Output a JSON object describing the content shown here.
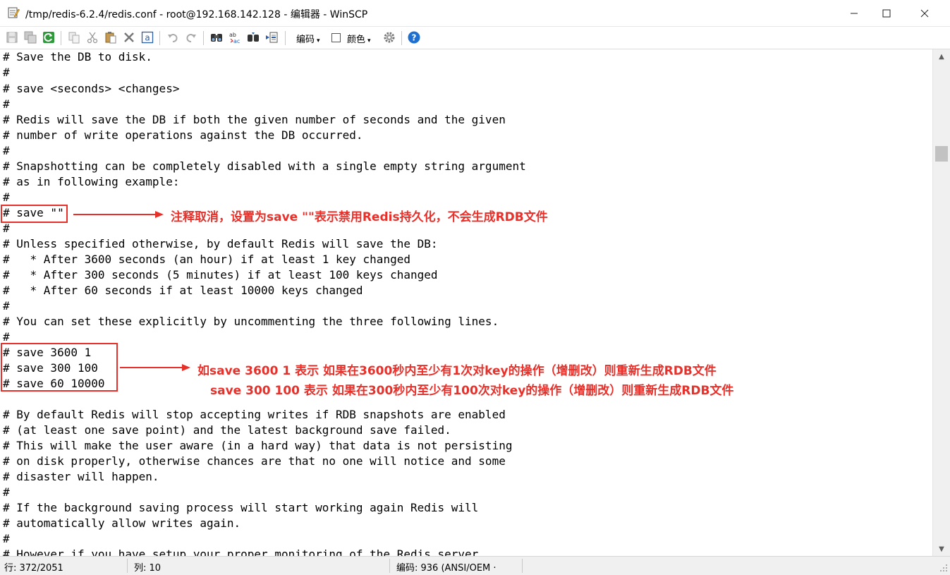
{
  "window": {
    "title": "/tmp/redis-6.2.4/redis.conf - root@192.168.142.128 - 编辑器 - WinSCP",
    "minimize_glyph": "—",
    "maximize_glyph": "☐",
    "close_glyph": "✕"
  },
  "toolbar": {
    "encoding_label": "编码",
    "color_label": "颜色",
    "dropdown_arrow": "▾",
    "icons": [
      "save-icon",
      "save-all-icon",
      "reload-icon",
      "copy-icon",
      "cut-icon",
      "paste-icon",
      "delete-icon",
      "select-all-icon",
      "undo-icon",
      "redo-icon",
      "find-icon",
      "replace-icon",
      "find-next-icon",
      "goto-line-icon",
      "settings-icon",
      "help-icon"
    ]
  },
  "editor": {
    "lines": [
      "# Save the DB to disk.",
      "#",
      "# save <seconds> <changes>",
      "#",
      "# Redis will save the DB if both the given number of seconds and the given",
      "# number of write operations against the DB occurred.",
      "#",
      "# Snapshotting can be completely disabled with a single empty string argument",
      "# as in following example:",
      "#",
      "# save \"\"",
      "#",
      "# Unless specified otherwise, by default Redis will save the DB:",
      "#   * After 3600 seconds (an hour) if at least 1 key changed",
      "#   * After 300 seconds (5 minutes) if at least 100 keys changed",
      "#   * After 60 seconds if at least 10000 keys changed",
      "#",
      "# You can set these explicitly by uncommenting the three following lines.",
      "#",
      "# save 3600 1",
      "# save 300 100",
      "# save 60 10000",
      "",
      "# By default Redis will stop accepting writes if RDB snapshots are enabled",
      "# (at least one save point) and the latest background save failed.",
      "# This will make the user aware (in a hard way) that data is not persisting",
      "# on disk properly, otherwise chances are that no one will notice and some",
      "# disaster will happen.",
      "#",
      "# If the background saving process will start working again Redis will",
      "# automatically allow writes again.",
      "#",
      "# However if you have setup your proper monitoring of the Redis server"
    ]
  },
  "annotations": {
    "note1": "注释取消，设置为save \"\"表示禁用Redis持久化，不会生成RDB文件",
    "note2_line1": "如save 3600 1 表示 如果在3600秒内至少有1次对key的操作（增删改）则重新生成RDB文件",
    "note2_line2": "save 300 100 表示 如果在300秒内至少有100次对key的操作（增删改）则重新生成RDB文件",
    "color": "#e8302a"
  },
  "statusbar": {
    "line": "行: 372/2051",
    "column": "列: 10",
    "encoding": "编码: 936  (ANSI/OEM ·"
  },
  "scrollbar": {
    "up_glyph": "▲",
    "down_glyph": "▼"
  }
}
